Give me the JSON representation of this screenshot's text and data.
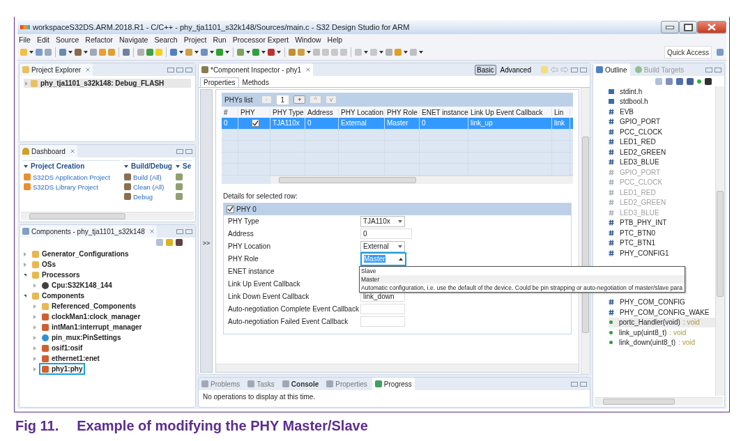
{
  "window": {
    "title": "workspaceS32DS.ARM.2018.R1 - C/C++ - phy_tja1101_s32k148/Sources/main.c - S32 Design Studio for ARM"
  },
  "menu": [
    "File",
    "Edit",
    "Source",
    "Refactor",
    "Navigate",
    "Search",
    "Project",
    "Run",
    "Processor Expert",
    "Window",
    "Help"
  ],
  "toolbar": {
    "placeholder": "Quick Access"
  },
  "project_explorer": {
    "title": "Project Explorer",
    "items": [
      {
        "label": "phy_tja1101_s32k148: Debug_FLASH",
        "expanded": false,
        "selected": true
      }
    ]
  },
  "dashboard": {
    "title": "Dashboard",
    "sections": [
      {
        "title": "Project Creation",
        "items": [
          "S32DS Application Project",
          "S32DS Library Project"
        ]
      },
      {
        "title": "Build/Debug",
        "items": [
          "Build  (All)",
          "Clean  (All)",
          "Debug"
        ]
      },
      {
        "title": "Se"
      }
    ]
  },
  "components": {
    "title": "Components - phy_tja1101_s32k148",
    "tree": [
      {
        "label": "Generator_Configurations",
        "kind": "folder",
        "expanded": false,
        "highlighted": false
      },
      {
        "label": "OSs",
        "kind": "folder",
        "expanded": false,
        "highlighted": false
      },
      {
        "label": "Processors",
        "kind": "folder",
        "expanded": true,
        "highlighted": false,
        "children": [
          {
            "label": "Cpu:S32K148_144",
            "kind": "chip",
            "expanded": false,
            "highlighted": false
          }
        ]
      },
      {
        "label": "Components",
        "kind": "folder",
        "expanded": true,
        "highlighted": false,
        "children": [
          {
            "label": "Referenced_Components",
            "kind": "folder",
            "expanded": false,
            "highlighted": false
          },
          {
            "label": "clockMan1:clock_manager",
            "kind": "component",
            "expanded": false,
            "highlighted": false
          },
          {
            "label": "intMan1:interrupt_manager",
            "kind": "component",
            "expanded": false,
            "highlighted": false
          },
          {
            "label": "pin_mux:PinSettings",
            "kind": "pins",
            "expanded": false,
            "highlighted": false
          },
          {
            "label": "osif1:osif",
            "kind": "component",
            "expanded": false,
            "highlighted": false
          },
          {
            "label": "ethernet1:enet",
            "kind": "component",
            "expanded": false,
            "highlighted": false
          },
          {
            "label": "phy1:phy",
            "kind": "component",
            "expanded": false,
            "highlighted": true
          }
        ]
      }
    ]
  },
  "inspector": {
    "title": "*Component Inspector - phy1",
    "modes": [
      {
        "label": "Basic",
        "selected": true
      },
      {
        "label": "Advanced",
        "selected": false
      }
    ],
    "tabs": [
      {
        "label": "Properties",
        "selected": true
      },
      {
        "label": "Methods",
        "selected": false
      }
    ],
    "gutter": ">>",
    "phys_list": {
      "label": "PHYs list",
      "remove": "-",
      "count": "1",
      "add": "+",
      "up": "^",
      "down": "v",
      "columns": [
        "#",
        "PHY",
        "PHY Type",
        "Address",
        "PHY Location",
        "PHY Role",
        "ENET instance",
        "Link Up Event Callback",
        "Lin"
      ],
      "rows": [
        {
          "phy_checked": true,
          "selected": true,
          "cells": [
            "0",
            "",
            "TJA110x",
            "0",
            "External",
            "Master",
            "0",
            "link_up",
            "link"
          ]
        }
      ]
    },
    "details_label": "Details for selected row:",
    "group": {
      "label": "PHY 0",
      "checked": true
    },
    "fields": [
      {
        "label": "PHY Type",
        "kind": "combo",
        "value": "TJA110x",
        "open": false,
        "highlighted": false
      },
      {
        "label": "Address",
        "kind": "text",
        "value": "0"
      },
      {
        "label": "PHY Location",
        "kind": "combo",
        "value": "External",
        "open": false,
        "highlighted": false
      },
      {
        "label": "PHY Role",
        "kind": "combo",
        "value": "Master",
        "open": true,
        "highlighted": true,
        "options": [
          {
            "label": "Slave",
            "selected": false
          },
          {
            "label": "Master",
            "selected": true
          },
          {
            "label": "Automatic configuration, i.e. use the default of the device. Could be pin strapping or auto-negotiation of master/slave para",
            "selected": false
          }
        ]
      },
      {
        "label": "ENET instance",
        "kind": "label"
      },
      {
        "label": "Link Up Event Callback",
        "kind": "label"
      },
      {
        "label": "Link Down Event Callback",
        "kind": "text",
        "value": "link_down"
      },
      {
        "label": "Auto-negotiation Complete Event Callback",
        "kind": "text"
      },
      {
        "label": "Auto-negotiation Failed Event Callback",
        "kind": "text"
      }
    ]
  },
  "outline": {
    "tabs": [
      {
        "label": "Outline",
        "selected": true
      },
      {
        "label": "Build Targets",
        "selected": false
      }
    ],
    "items": [
      {
        "kind": "include",
        "label": "stdint.h"
      },
      {
        "kind": "include",
        "label": "stdbool.h"
      },
      {
        "kind": "define",
        "label": "EVB"
      },
      {
        "kind": "define",
        "label": "GPIO_PORT"
      },
      {
        "kind": "define",
        "label": "PCC_CLOCK"
      },
      {
        "kind": "define",
        "label": "LED1_RED"
      },
      {
        "kind": "define",
        "label": "LED2_GREEN"
      },
      {
        "kind": "define",
        "label": "LED3_BLUE"
      },
      {
        "kind": "undef",
        "label": "GPIO_PORT"
      },
      {
        "kind": "undef",
        "label": "PCC_CLOCK"
      },
      {
        "kind": "undef",
        "label": "LED1_RED"
      },
      {
        "kind": "undef",
        "label": "LED2_GREEN"
      },
      {
        "kind": "undef",
        "label": "LED3_BLUE"
      },
      {
        "kind": "define",
        "label": "PTB_PHY_INT"
      },
      {
        "kind": "define",
        "label": "PTC_BTN0"
      },
      {
        "kind": "define",
        "label": "PTC_BTN1"
      },
      {
        "kind": "define",
        "label": "PHY_CONFIG1"
      }
    ],
    "items_lower": [
      {
        "kind": "define",
        "label": "PHY_COM_CONFIG"
      },
      {
        "kind": "define",
        "label": "PHY_COM_CONFIG_WAKE"
      },
      {
        "kind": "function",
        "label": "portc_Handler(void)",
        "returns": ": void",
        "selected": true
      },
      {
        "kind": "function",
        "label": "link_up(uint8_t)",
        "returns": ": void",
        "selected": false
      },
      {
        "kind": "function",
        "label": "link_down(uint8_t)",
        "returns": ": void",
        "selected": false
      }
    ]
  },
  "bottom": {
    "tabs": [
      {
        "label": "Problems",
        "selected": false,
        "bold": false
      },
      {
        "label": "Tasks",
        "selected": false,
        "bold": false
      },
      {
        "label": "Console",
        "selected": false,
        "bold": true
      },
      {
        "label": "Properties",
        "selected": false,
        "bold": false
      },
      {
        "label": "Progress",
        "selected": true,
        "bold": false
      }
    ],
    "message": "No operations to display at this time."
  },
  "caption": {
    "number": "Fig 11.",
    "text": "Example of modifying the PHY Master/Slave"
  }
}
